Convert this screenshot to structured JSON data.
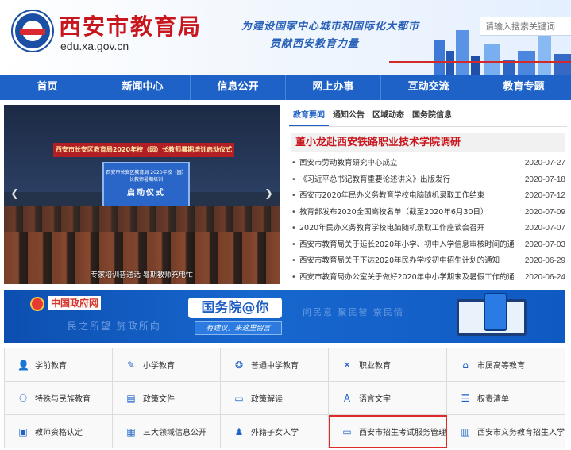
{
  "header": {
    "title": "西安市教育局",
    "domain": "edu.xa.gov.cn",
    "slogan_line1": "为建设国家中心城市和国际化大都市",
    "slogan_line2": "贡献西安教育力量",
    "search_placeholder": "请输入搜索关键词"
  },
  "nav": [
    "首页",
    "新闻中心",
    "信息公开",
    "网上办事",
    "互动交流",
    "教育专题"
  ],
  "slide": {
    "banner": "西安市长安区教育局2020年校（园）长教师暑期培训启动仪式",
    "screen_line1": "西安市长安区教育局 2020年校（园）长教师暑期培训",
    "screen_line2": "启动仪式",
    "caption": "专家培训普通话 暑期教师充电忙"
  },
  "news": {
    "tabs": [
      "教育要闻",
      "通知公告",
      "区域动态",
      "国务院信息"
    ],
    "active_tab": "教育要闻",
    "headline": "董小龙赴西安铁路职业技术学院调研",
    "items": [
      {
        "title": "西安市劳动教育研究中心成立",
        "date": "2020-07-27"
      },
      {
        "title": "《习近平总书记教育重要论述讲义》出版发行",
        "date": "2020-07-18"
      },
      {
        "title": "西安市2020年民办义务教育学校电脑随机录取工作结束",
        "date": "2020-07-12"
      },
      {
        "title": "教育部发布2020全国高校名单（截至2020年6月30日）",
        "date": "2020-07-09"
      },
      {
        "title": "2020年民办义务教育学校电脑随机录取工作座谈会召开",
        "date": "2020-07-07"
      },
      {
        "title": "西安市教育局关于延长2020年小学、初中入学信息审核时间的通知",
        "date": "2020-07-03"
      },
      {
        "title": "西安市教育局关于下达2020年民办学校初中招生计划的通知",
        "date": "2020-06-29"
      },
      {
        "title": "西安市教育局办公室关于做好2020年中小学期末及暑假工作的通知",
        "date": "2020-06-24"
      }
    ]
  },
  "gov_banner": {
    "logo": "中国政府网",
    "left_tags": "民之所望  施政所向",
    "main": "国务院@你",
    "sub": "有建议，来这里留言",
    "right_tags": "问民意  聚民智  察民情"
  },
  "services": [
    {
      "label": "学前教育",
      "icon": "person-icon"
    },
    {
      "label": "小学教育",
      "icon": "pencil-icon"
    },
    {
      "label": "普通中学教育",
      "icon": "book-icon"
    },
    {
      "label": "职业教育",
      "icon": "tools-icon"
    },
    {
      "label": "市属高等教育",
      "icon": "cap-icon"
    },
    {
      "label": "特殊与民族教育",
      "icon": "people-icon"
    },
    {
      "label": "政策文件",
      "icon": "folder-icon"
    },
    {
      "label": "政策解读",
      "icon": "chat-icon"
    },
    {
      "label": "语言文字",
      "icon": "a-icon"
    },
    {
      "label": "权责清单",
      "icon": "list-icon"
    },
    {
      "label": "教师资格认定",
      "icon": "id-card-icon"
    },
    {
      "label": "三大领域信息公开",
      "icon": "doc-icon"
    },
    {
      "label": "外籍子女入学",
      "icon": "user-icon"
    },
    {
      "label": "西安市招生考试服务管理",
      "icon": "monitor-icon"
    },
    {
      "label": "西安市义务教育招生入学",
      "icon": "grid-icon"
    }
  ]
}
